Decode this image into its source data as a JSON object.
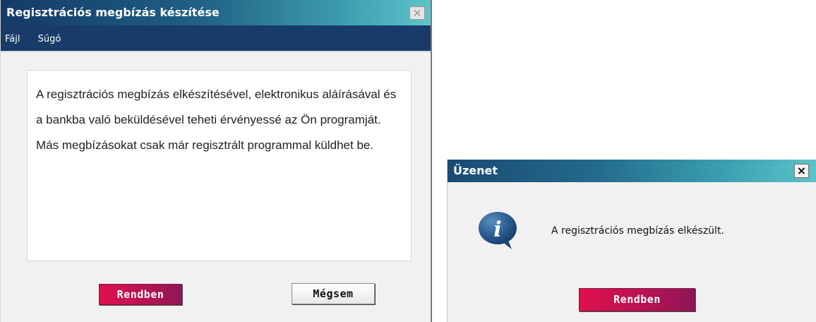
{
  "main_window": {
    "title": "Regisztrációs megbízás készítése",
    "close_glyph": "×",
    "menu": [
      {
        "label": "Fájl"
      },
      {
        "label": "Súgó"
      }
    ],
    "body_paragraphs": [
      "A regisztrációs megbízás elkészítésével, elektronikus aláírásával és a bankba való beküldésével teheti érvényessé az Ön programját.",
      "Más megbízásokat csak már regisztrált programmal küldhet be."
    ],
    "ok_label": "Rendben",
    "cancel_label": "Mégsem"
  },
  "message_dialog": {
    "title": "Üzenet",
    "close_glyph": "×",
    "icon": "info-icon",
    "message": "A regisztrációs megbízás elkészült.",
    "ok_label": "Rendben"
  },
  "colors": {
    "titlebar_dark": "#143a66",
    "titlebar_light": "#5ec4c9",
    "menubar": "#183b69",
    "primary_button": "#d0104f"
  }
}
